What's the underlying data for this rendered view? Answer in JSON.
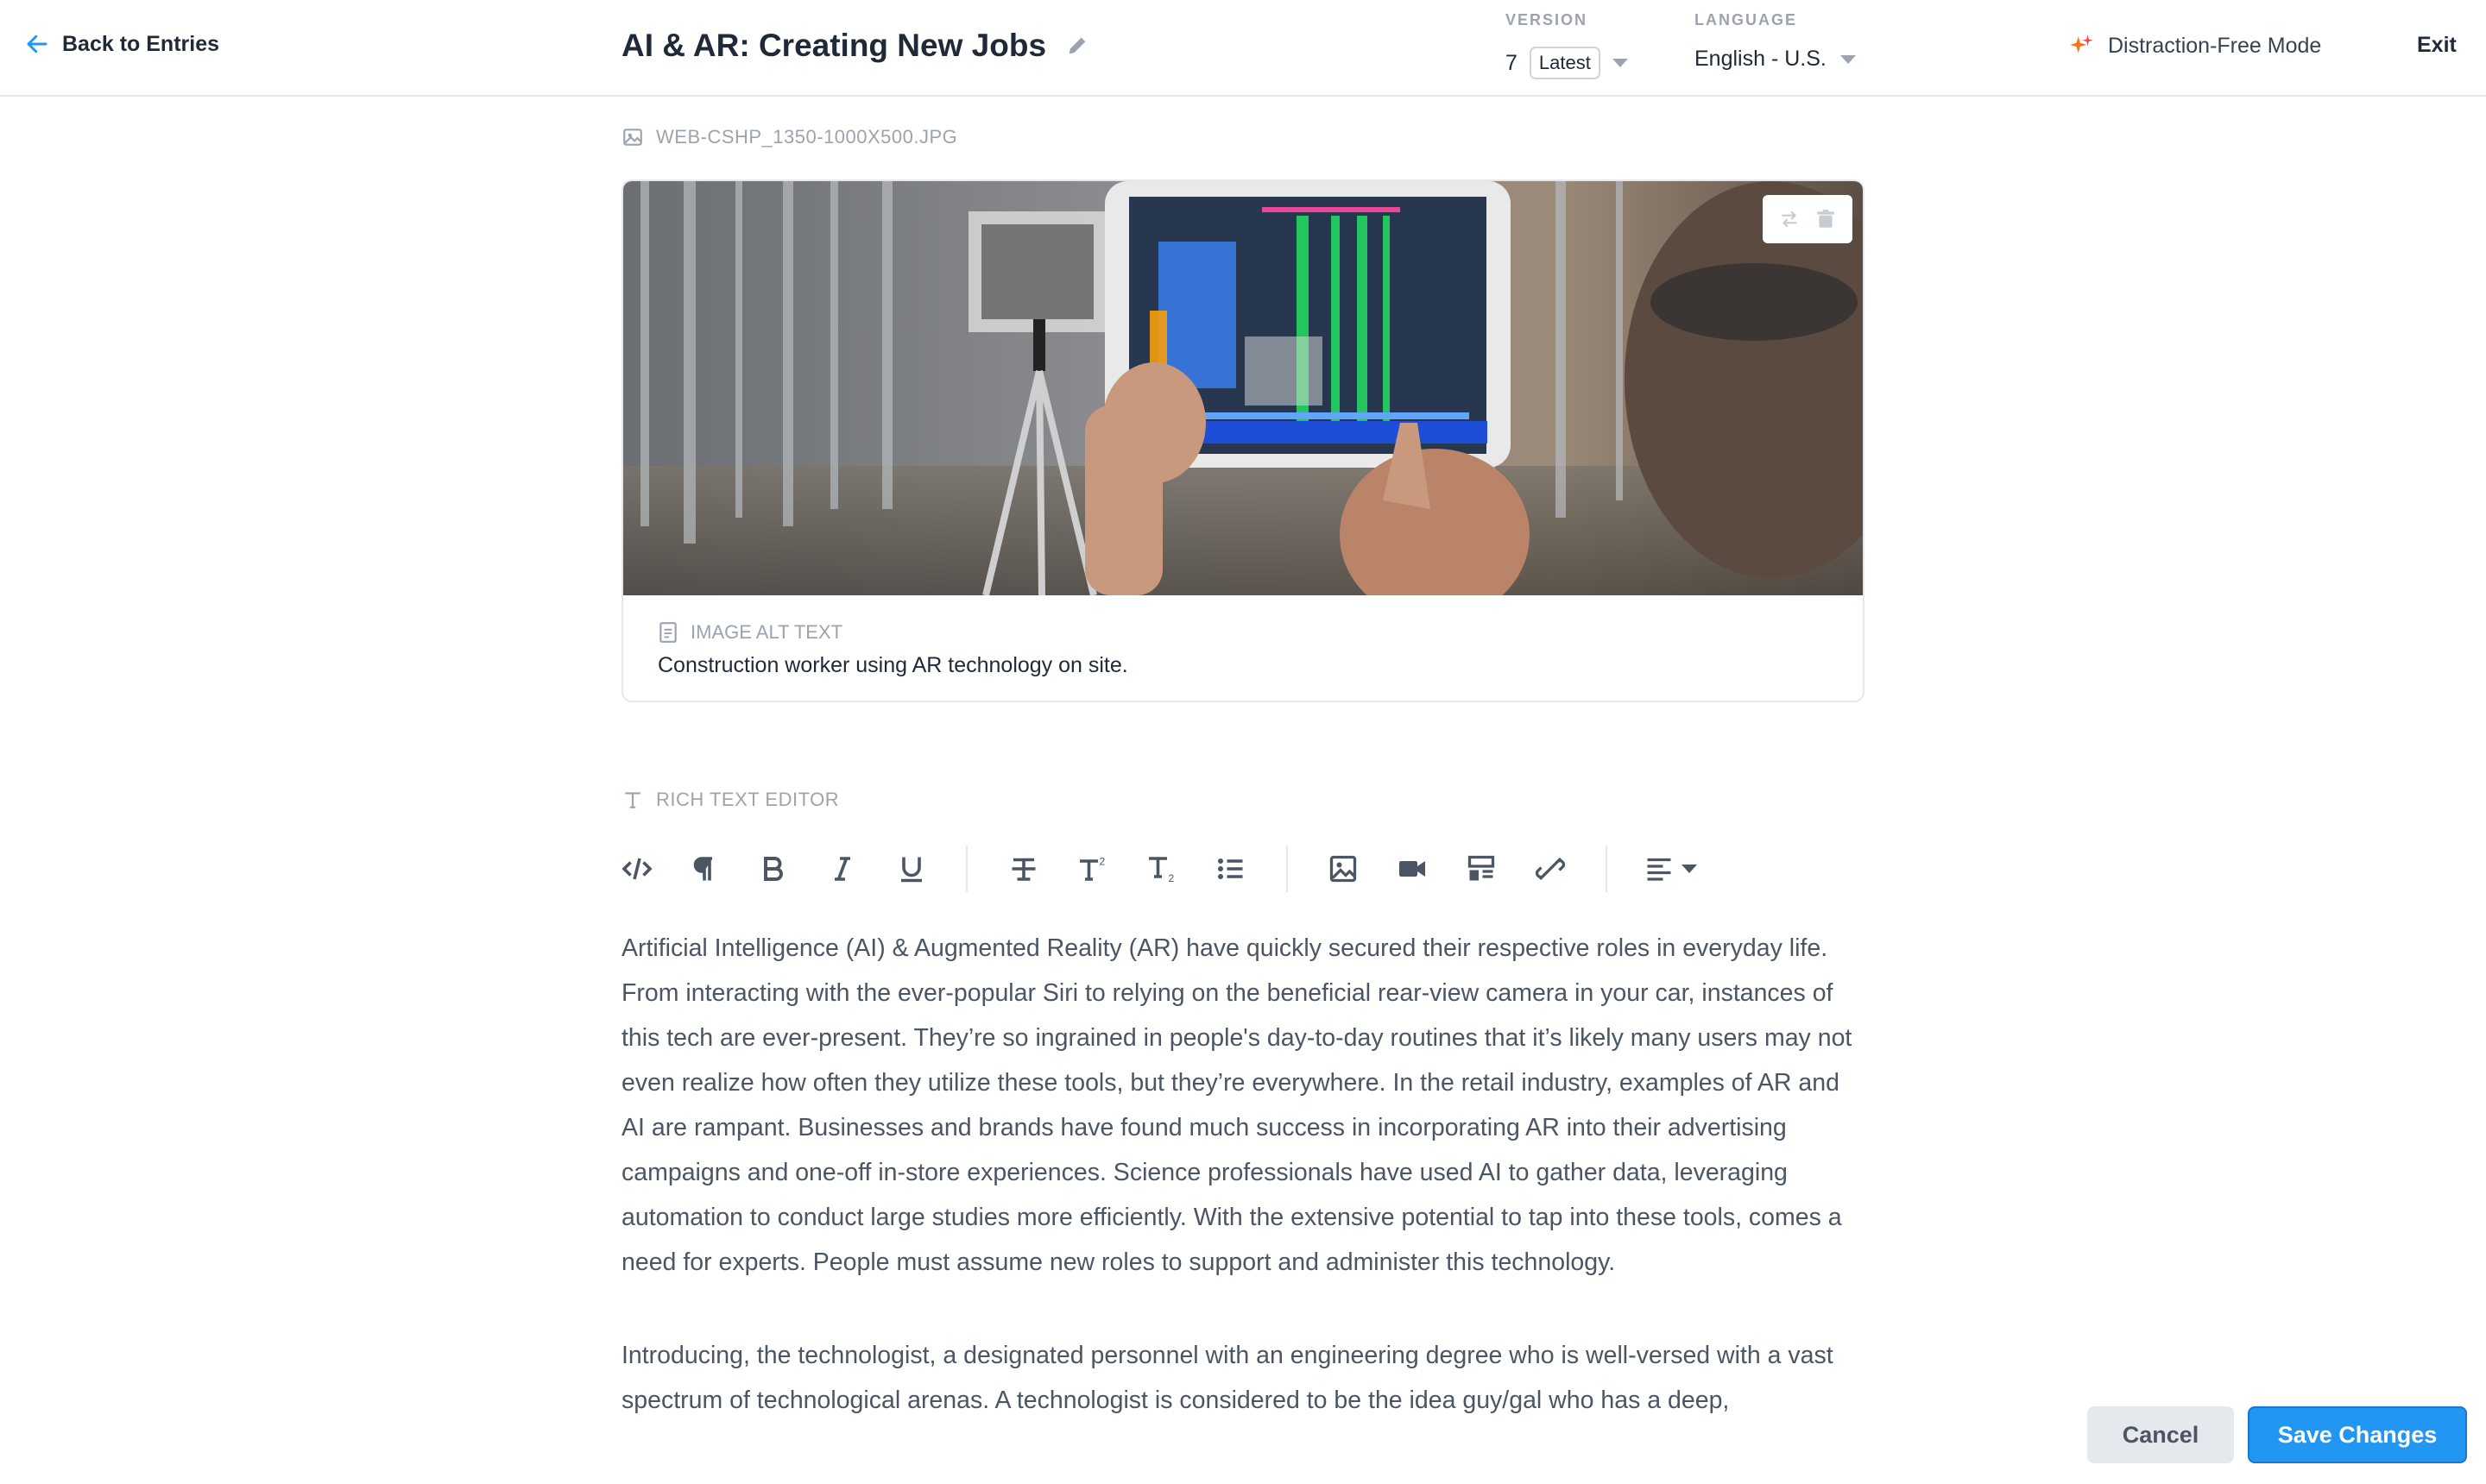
{
  "header": {
    "back_label": "Back to Entries",
    "title": "AI & AR: Creating New Jobs",
    "version_label": "VERSION",
    "version_number": "7",
    "version_tag": "Latest",
    "language_label": "LANGUAGE",
    "language_value": "English - U.S.",
    "distraction_free_label": "Distraction-Free Mode",
    "exit_label": "Exit"
  },
  "image_field": {
    "filename": "WEB-CSHP_1350-1000X500.JPG",
    "alt_label": "IMAGE ALT TEXT",
    "alt_text": "Construction worker using AR technology on site.",
    "photo_description_icons": [
      "swap-icon",
      "trash-icon"
    ]
  },
  "editor": {
    "label": "RICH TEXT EDITOR",
    "toolbar_icons": [
      "code-icon",
      "paragraph-icon",
      "bold-icon",
      "italic-icon",
      "underline-icon",
      "strikethrough-icon",
      "superscript-icon",
      "subscript-icon",
      "bulleted-list-icon",
      "insert-image-icon",
      "insert-video-icon",
      "insert-gallery-icon",
      "unlink-icon",
      "align-left-icon"
    ],
    "paragraphs": [
      "Artificial Intelligence (AI) & Augmented Reality (AR) have quickly secured their respective roles in everyday life. From interacting with the ever-popular Siri to relying on the beneficial rear-view camera in your car, instances of this tech are ever-present. They’re so ingrained in people's day-to-day routines that it’s likely many users may not even realize how often they utilize these tools, but they’re everywhere. In the retail industry, examples of AR and AI are rampant. Businesses and brands have found much success in incorporating AR into their advertising campaigns and one-off in-store experiences. Science professionals have used AI to gather data, leveraging automation to conduct large studies more efficiently. With the extensive potential to tap into these tools, comes a need for experts. People must assume new roles to support and administer this technology.",
      "Introducing, the technologist, a designated personnel with an engineering degree who is well-versed with a vast spectrum of technological arenas. A technologist is considered to be the idea guy/gal who has a deep,"
    ]
  },
  "actions": {
    "cancel_label": "Cancel",
    "save_label": "Save Changes"
  },
  "colors": {
    "accent": "#2196f3",
    "spark": "#f97316",
    "muted": "#9ca3af",
    "text": "#1f2937"
  }
}
